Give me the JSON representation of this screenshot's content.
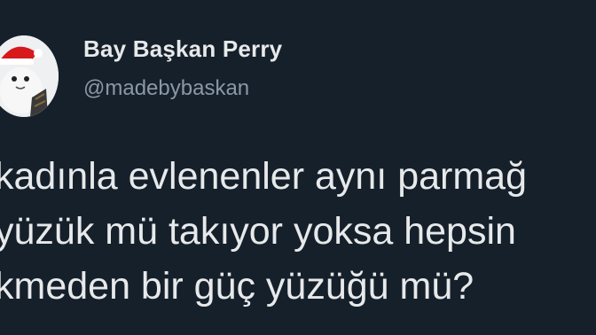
{
  "tweet": {
    "author": {
      "display_name": "Bay Başkan Perry",
      "handle": "@madebybaskan",
      "avatar_icon": "santa-avatar-icon"
    },
    "text_lines": [
      "kadınla evlenenler aynı parmağ",
      "yüzük mü takıyor yoksa hepsin",
      "kmeden bir güç yüzüğü mü?"
    ]
  },
  "colors": {
    "background": "#15202b",
    "primary_text": "#e7e9ea",
    "secondary_text": "#8b98a5"
  }
}
